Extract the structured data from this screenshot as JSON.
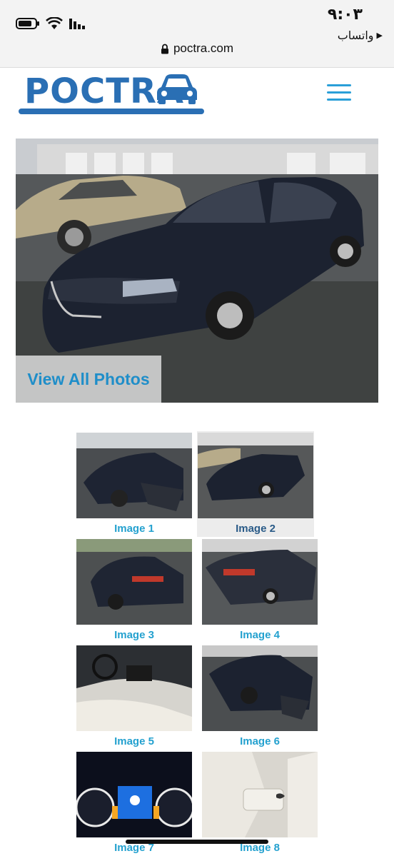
{
  "status_bar": {
    "time": "٩:٠٣",
    "back_app": "واتساب",
    "back_arrow": "▶"
  },
  "address_bar": {
    "url": "poctra.com"
  },
  "header": {
    "logo_text": "POCTRA",
    "menu_icon": "hamburger-icon"
  },
  "hero": {
    "view_all_label": "View All Photos"
  },
  "thumbnails": [
    {
      "label": "Image 1"
    },
    {
      "label": "Image 2",
      "selected": true
    },
    {
      "label": "Image 3"
    },
    {
      "label": "Image 4"
    },
    {
      "label": "Image 5"
    },
    {
      "label": "Image 6"
    },
    {
      "label": "Image 7"
    },
    {
      "label": "Image 8"
    }
  ],
  "colors": {
    "brand_blue": "#2a6fb4",
    "link_blue": "#24a1cf"
  }
}
